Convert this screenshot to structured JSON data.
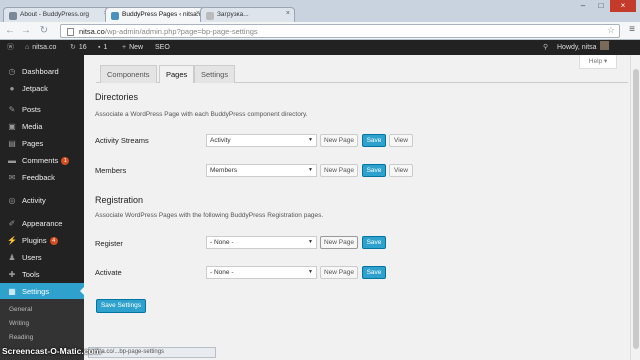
{
  "browser": {
    "tabs": [
      {
        "title": "About - BuddyPress.org"
      },
      {
        "title": "BuddyPress Pages ‹ nitsa.c"
      },
      {
        "title": "Загрузка..."
      }
    ],
    "url_host": "nitsa.co",
    "url_path": "/wp-admin/admin.php?page=bp-page-settings",
    "status_url": "nitsa.co/...bp-page-settings"
  },
  "adminbar": {
    "site_name": "nitsa.co",
    "updates_count": "16",
    "comments_count": "1",
    "new_label": "New",
    "seo_label": "SEO",
    "howdy": "Howdy, nitsa"
  },
  "sidebar": {
    "items": [
      {
        "label": "Dashboard",
        "icon": "dashboard-icon"
      },
      {
        "label": "Jetpack",
        "icon": "jetpack-icon"
      },
      {
        "label": "Posts",
        "icon": "pin-icon"
      },
      {
        "label": "Media",
        "icon": "media-icon"
      },
      {
        "label": "Pages",
        "icon": "page-icon"
      },
      {
        "label": "Comments",
        "icon": "comment-icon",
        "badge": "1"
      },
      {
        "label": "Feedback",
        "icon": "feedback-icon"
      },
      {
        "label": "Activity",
        "icon": "activity-icon"
      },
      {
        "label": "Appearance",
        "icon": "brush-icon"
      },
      {
        "label": "Plugins",
        "icon": "plug-icon",
        "badge": "4"
      },
      {
        "label": "Users",
        "icon": "users-icon"
      },
      {
        "label": "Tools",
        "icon": "wrench-icon"
      },
      {
        "label": "Settings",
        "icon": "settings-icon"
      }
    ],
    "submenu": [
      "General",
      "Writing",
      "Reading"
    ]
  },
  "help_label": "Help ▾",
  "tabs": [
    "Components",
    "Pages",
    "Settings"
  ],
  "directories": {
    "heading": "Directories",
    "description": "Associate a WordPress Page with each BuddyPress component directory.",
    "rows": [
      {
        "label": "Activity Streams",
        "selected": "Activity",
        "new_page": "New Page",
        "save": "Save",
        "view": "View"
      },
      {
        "label": "Members",
        "selected": "Members",
        "new_page": "New Page",
        "save": "Save",
        "view": "View"
      }
    ]
  },
  "registration": {
    "heading": "Registration",
    "description": "Associate WordPress Pages with the following BuddyPress Registration pages.",
    "rows": [
      {
        "label": "Register",
        "selected": "- None -",
        "new_page": "New Page",
        "save": "Save"
      },
      {
        "label": "Activate",
        "selected": "- None -",
        "new_page": "New Page",
        "save": "Save"
      }
    ]
  },
  "save_settings": "Save Settings",
  "watermark": "Screencast-O-Matic.com",
  "colors": {
    "accent": "#2ea2cc",
    "adminbar": "#222222",
    "sidebar": "#222222",
    "content_bg": "#f1f1f1"
  }
}
